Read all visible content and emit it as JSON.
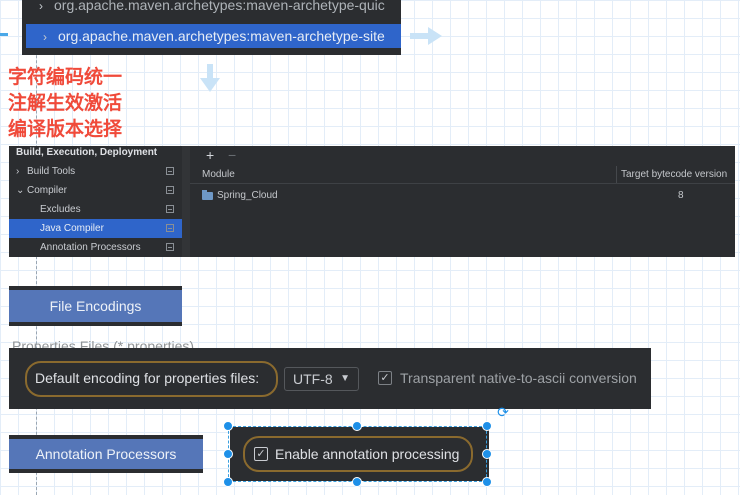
{
  "maven": {
    "top_item": "org.apache.maven.archetypes:maven-archetype-quic",
    "selected_item": "org.apache.maven.archetypes:maven-archetype-site",
    "bottom_item": "org.apache.maven.archetypes:maven-archetype-site"
  },
  "notes": {
    "line1": "字符编码统一",
    "line2": "注解生效激活",
    "line3": "编译版本选择"
  },
  "settings": {
    "section_title": "Build, Execution, Deployment",
    "sidebar_items": [
      {
        "label": "Build Tools",
        "expander": "›"
      },
      {
        "label": "Compiler",
        "expander": "⌄"
      },
      {
        "label": "Excludes",
        "expander": ""
      },
      {
        "label": "Java Compiler",
        "expander": ""
      },
      {
        "label": "Annotation Processors",
        "expander": ""
      }
    ],
    "toolbar_add": "+",
    "toolbar_remove": "−",
    "table_headers": [
      "Module",
      "Target bytecode version"
    ],
    "rows": [
      {
        "module": "Spring_Cloud",
        "version": "8"
      }
    ]
  },
  "file_encodings": {
    "title": "File Encodings",
    "properties_section": "Properties Files (*.properties)",
    "default_label": "Default encoding for properties files:",
    "encoding_value": "UTF-8",
    "native_ascii_label": "Transparent native-to-ascii conversion",
    "native_ascii_checked": true
  },
  "annotation": {
    "title": "Annotation Processors",
    "enable_label": "Enable annotation processing",
    "enable_checked": true
  }
}
